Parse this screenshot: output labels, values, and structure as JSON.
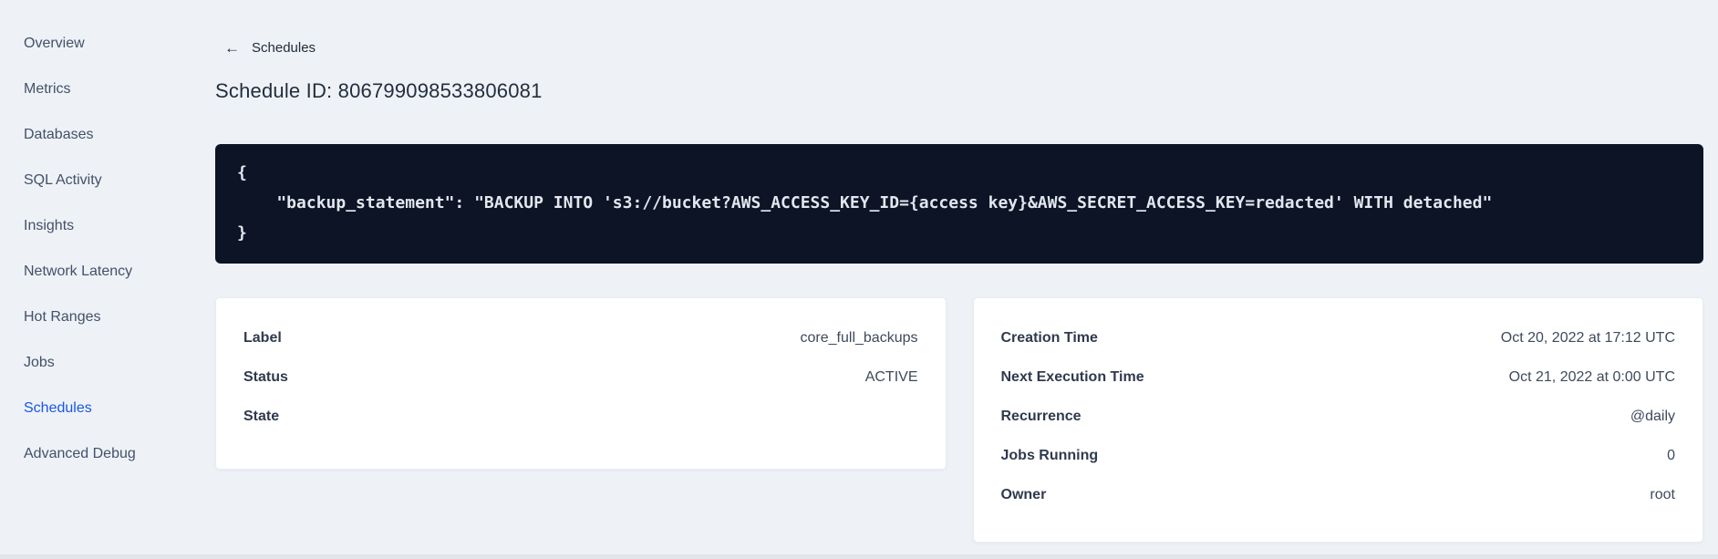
{
  "colors": {
    "page_background": "#eef2f6",
    "active_nav": "#1a56e8",
    "code_background": "#0c1425",
    "code_text": "#e2e7ef",
    "card_background": "#ffffff"
  },
  "sidebar": {
    "items": [
      {
        "label": "Overview",
        "active": false
      },
      {
        "label": "Metrics",
        "active": false
      },
      {
        "label": "Databases",
        "active": false
      },
      {
        "label": "SQL Activity",
        "active": false
      },
      {
        "label": "Insights",
        "active": false
      },
      {
        "label": "Network Latency",
        "active": false
      },
      {
        "label": "Hot Ranges",
        "active": false
      },
      {
        "label": "Jobs",
        "active": false
      },
      {
        "label": "Schedules",
        "active": true
      },
      {
        "label": "Advanced Debug",
        "active": false
      }
    ]
  },
  "header": {
    "back_icon": "←",
    "back_label": "Schedules",
    "title": "Schedule ID: 806799098533806081"
  },
  "code_block": {
    "text": "{\n    \"backup_statement\": \"BACKUP INTO 's3://bucket?AWS_ACCESS_KEY_ID={access key}&AWS_SECRET_ACCESS_KEY=redacted' WITH detached\"\n}"
  },
  "status_card": {
    "rows": [
      {
        "label": "Label",
        "value": "core_full_backups"
      },
      {
        "label": "Status",
        "value": "ACTIVE"
      },
      {
        "label": "State",
        "value": ""
      }
    ]
  },
  "schedule_card": {
    "rows": [
      {
        "label": "Creation Time",
        "value": "Oct 20, 2022 at 17:12 UTC"
      },
      {
        "label": "Next Execution Time",
        "value": "Oct 21, 2022 at 0:00 UTC"
      },
      {
        "label": "Recurrence",
        "value": "@daily"
      },
      {
        "label": "Jobs Running",
        "value": "0"
      },
      {
        "label": "Owner",
        "value": "root"
      }
    ]
  }
}
